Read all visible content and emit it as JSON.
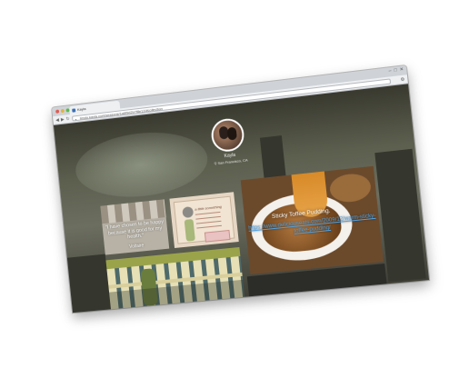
{
  "browser": {
    "tab_title": "Kayla",
    "url": "jimdo.kayla.com/seasons/1a6f9d2b7f8e12/#collection",
    "window_controls": [
      "–",
      "□",
      "✕"
    ],
    "traffic_lights": [
      "#e05a4f",
      "#e2b33e",
      "#5ab94a"
    ]
  },
  "profile": {
    "name": "Kayla",
    "location": "San Francisco, CA"
  },
  "cards": {
    "quote": {
      "text": "\"I have chosen to be happy because it is good for my health.\"",
      "author": "Voltaire"
    },
    "note": {
      "title": "a little something"
    },
    "pudding": {
      "title": "Sticky Toffee Pudding.",
      "link": "https://www.deliciouseats.com/2009/12/warm-sticky-toffee-pudding/"
    }
  },
  "icons": {
    "back": "back-arrow-icon",
    "forward": "forward-arrow-icon",
    "reload": "reload-icon",
    "lock": "lock-icon",
    "menu": "wrench-icon",
    "location": "pin-icon"
  }
}
